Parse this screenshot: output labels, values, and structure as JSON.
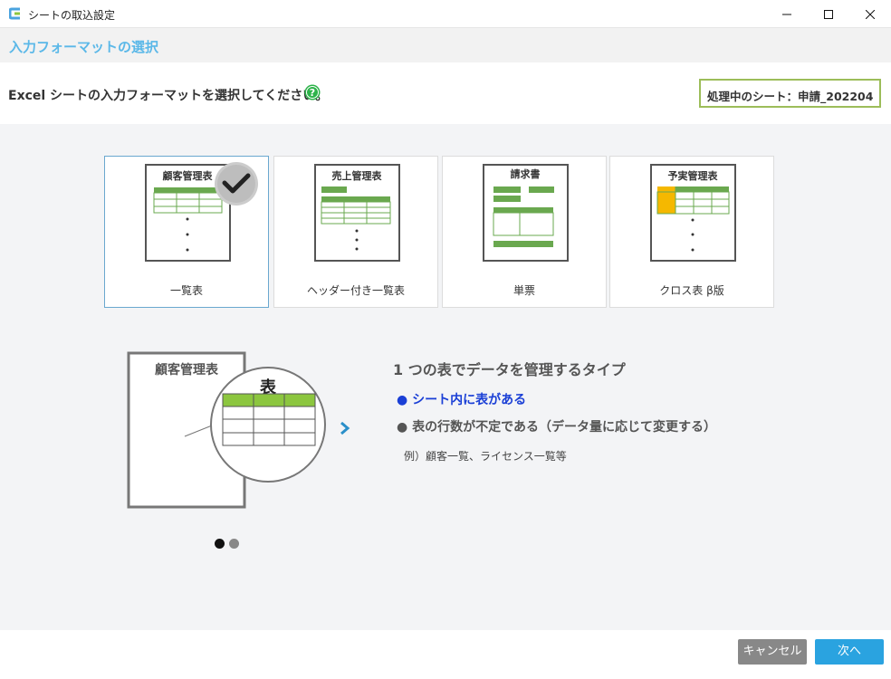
{
  "window": {
    "title": "シートの取込設定"
  },
  "section": {
    "title": "入力フォーマットの選択"
  },
  "instruction": {
    "text": "Excel シートの入力フォーマットを選択してください。"
  },
  "current_sheet": {
    "label": "処理中のシート：申請_202204"
  },
  "cards": [
    {
      "label": "一覧表",
      "doc_title": "顧客管理表",
      "selected": true
    },
    {
      "label": "ヘッダー付き一覧表",
      "doc_title": "売上管理表",
      "selected": false
    },
    {
      "label": "単票",
      "doc_title": "請求書",
      "selected": false
    },
    {
      "label": "クロス表 β版",
      "doc_title": "予実管理表",
      "selected": false
    }
  ],
  "preview": {
    "doc_title": "顧客管理表",
    "zoom_label": "表"
  },
  "description": {
    "title": "1 つの表でデータを管理するタイプ",
    "bullets": [
      "● シート内に表がある",
      "● 表の行数が不定である（データ量に応じて変更する）"
    ],
    "example": "例）顧客一覧、ライセンス一覧等"
  },
  "pager": {
    "current": 1,
    "total": 2
  },
  "footer": {
    "cancel_label": "キャンセル",
    "next_label": "次へ"
  },
  "colors": {
    "accent": "#5bb8e8",
    "green": "#6aa84f",
    "highlight_blue": "#1a3fd6",
    "next_button": "#2aa3e0",
    "cancel_button": "#888888",
    "sheet_border": "#9cbd59",
    "crosstab_yellow": "#f5b800"
  },
  "icons": {
    "help": "question-circle-icon",
    "check": "checkmark-icon",
    "next": "chevron-right-icon"
  }
}
